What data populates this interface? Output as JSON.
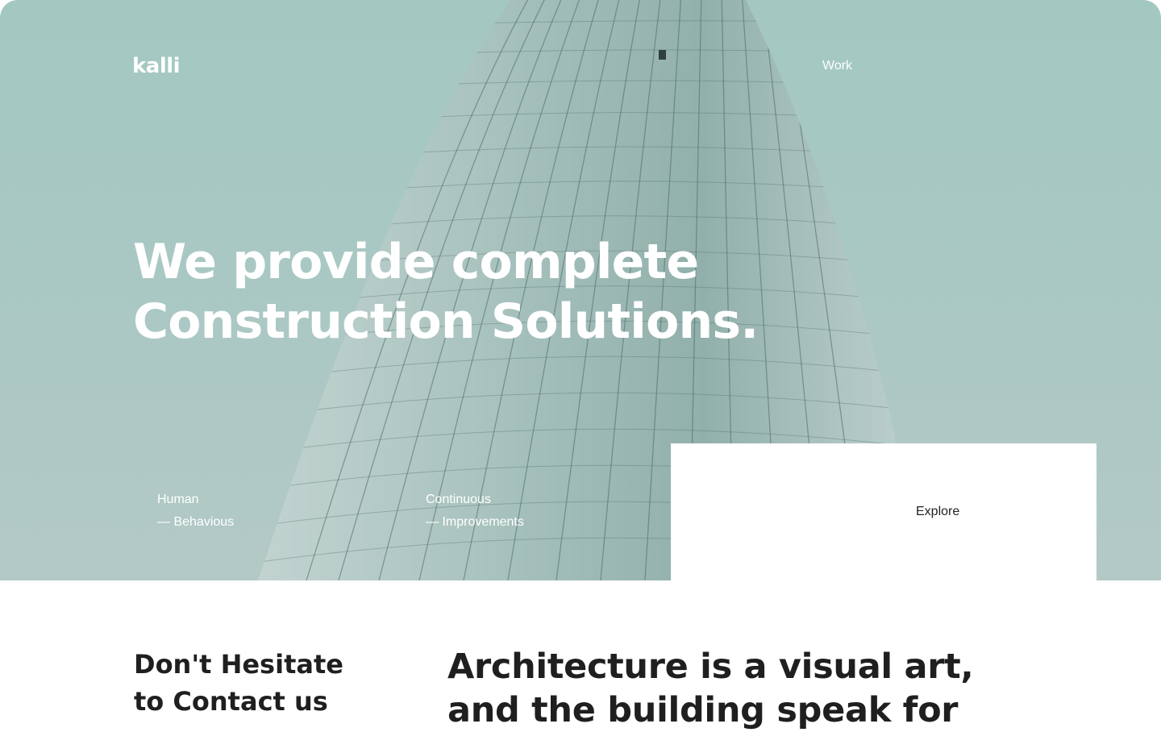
{
  "brand": {
    "name": "kalli"
  },
  "nav": {
    "work_label": "Work"
  },
  "hero": {
    "headline_line1": "We provide complete",
    "headline_line2": "Construction Solutions.",
    "features": [
      {
        "title": "Human",
        "subtitle": "— Behavious"
      },
      {
        "title": "Continuous",
        "subtitle": "— Improvements"
      }
    ],
    "explore_label": "Explore"
  },
  "contact": {
    "line1": "Don't Hesitate",
    "line2": "to Contact us"
  },
  "quote": {
    "line1": "Architecture is a visual art,",
    "line2": "and the building speak for"
  },
  "colors": {
    "sky": "#a9c8c3",
    "hero_text": "#ffffff",
    "dark_text": "#1f1f1f",
    "panel": "#ffffff"
  }
}
